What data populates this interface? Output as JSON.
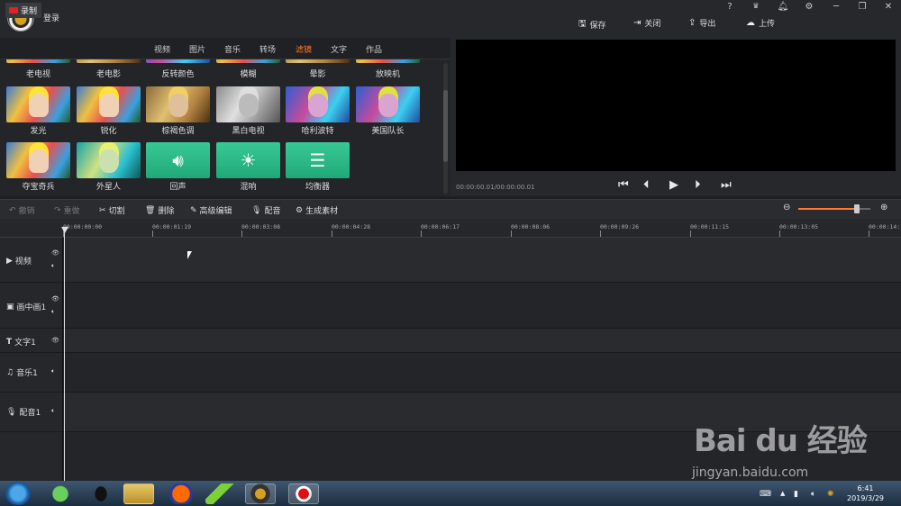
{
  "header": {
    "login_label": "登录",
    "window_buttons": [
      "?",
      "VIP",
      "bell",
      "gear",
      "minimize",
      "restore",
      "close"
    ],
    "actions": [
      {
        "icon": "save-icon",
        "label": "保存"
      },
      {
        "icon": "close-doc-icon",
        "label": "关闭"
      },
      {
        "icon": "export-icon",
        "label": "导出"
      },
      {
        "icon": "upload-icon",
        "label": "上传"
      }
    ]
  },
  "media_tabs": {
    "record_label": "录制",
    "tabs": [
      "视频",
      "图片",
      "音乐",
      "转场",
      "滤镜",
      "文字",
      "作品"
    ],
    "active_tab": "滤镜"
  },
  "filters": {
    "row1": [
      "老电视",
      "老电影",
      "反转颜色",
      "模糊",
      "晕影",
      "放映机"
    ],
    "row2": [
      "发光",
      "锐化",
      "棕褐色调",
      "黑白电视",
      "哈利波特",
      "美国队长"
    ],
    "row3": [
      "夺宝奇兵",
      "外星人",
      "回声",
      "混响",
      "均衡器"
    ]
  },
  "preview": {
    "time": "00:00:00.01/00:00:00.01",
    "controls": [
      "skip-start",
      "prev-frame",
      "play",
      "next-frame",
      "skip-end"
    ]
  },
  "edit_toolbar": {
    "undo": "撤销",
    "redo": "重做",
    "cut": "切割",
    "delete": "删除",
    "advanced_edit": "高级编辑",
    "dub": "配音",
    "generate_material": "生成素材"
  },
  "ruler": {
    "labels": [
      "00:00:00:00",
      "00:00:01:19",
      "00:00:03:08",
      "00:00:04:28",
      "00:00:06:17",
      "00:00:08:06",
      "00:00:09:26",
      "00:00:11:15",
      "00:00:13:05",
      "00:00:14:"
    ]
  },
  "tracks": [
    {
      "label": "视频",
      "icon": "video-icon"
    },
    {
      "label": "画中画1",
      "icon": "pip-icon"
    },
    {
      "label": "文字1",
      "icon": "text-icon"
    },
    {
      "label": "音乐1",
      "icon": "music-icon"
    },
    {
      "label": "配音1",
      "icon": "mic-icon"
    }
  ],
  "taskbar": {
    "time": "6:41",
    "date": "2019/3/29"
  },
  "watermark": {
    "brand": "Bai du 经验",
    "url": "jingyan.baidu.com"
  },
  "colors": {
    "accent": "#ff7a2e",
    "record": "#e32222",
    "green_filter": "#2eb987"
  }
}
